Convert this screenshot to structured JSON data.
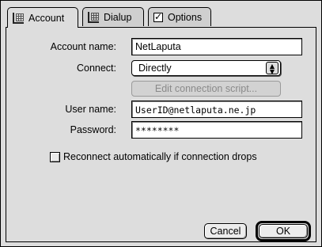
{
  "tabs": [
    {
      "label": "Account",
      "icon": "grid-icon"
    },
    {
      "label": "Dialup",
      "icon": "grid-icon"
    },
    {
      "label": "Options",
      "icon": "checkbox-icon"
    }
  ],
  "form": {
    "account_name_label": "Account name:",
    "account_name_value": "NetLaputa",
    "connect_label": "Connect:",
    "connect_value": "Directly",
    "edit_script_label": "Edit connection script...",
    "user_name_label": "User name:",
    "user_name_value": "UserID@netlaputa.ne.jp",
    "password_label": "Password:",
    "password_value": "********",
    "reconnect_label": "Reconnect automatically if connection drops",
    "reconnect_checked": false
  },
  "buttons": {
    "cancel": "Cancel",
    "ok": "OK"
  }
}
